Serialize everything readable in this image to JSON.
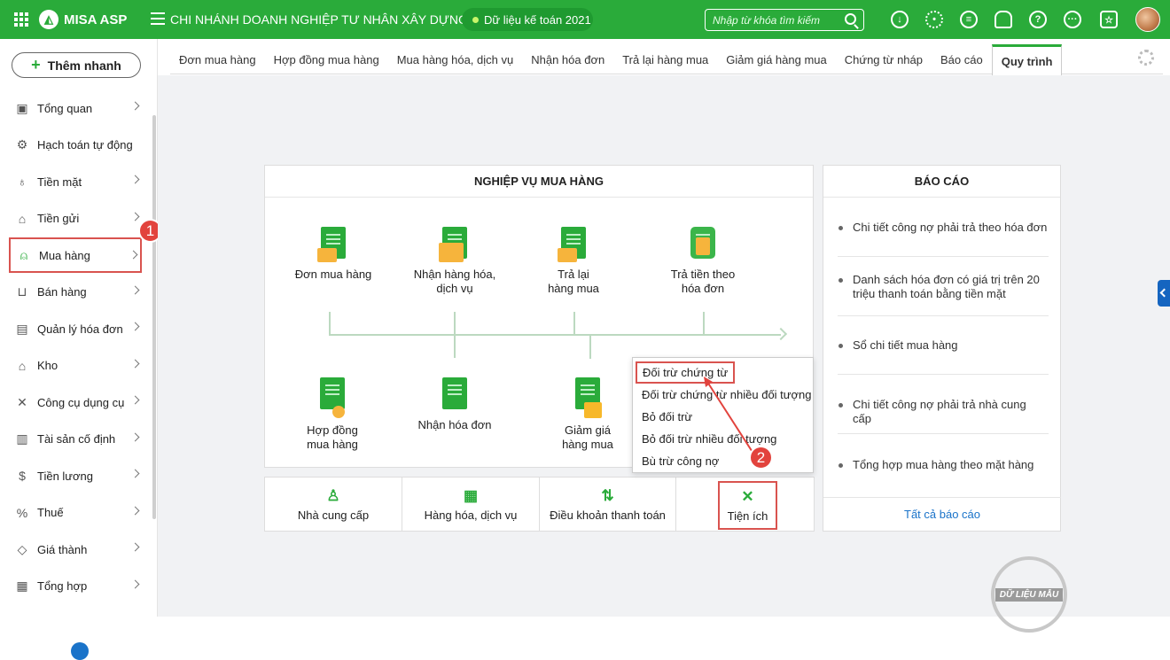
{
  "topbar": {
    "brand": "MISA ASP",
    "company": "CHI NHÁNH DOANH NGHIỆP TƯ NHÂN XÂY DỰNG ...",
    "db_label": "Dữ liệu kế toán 2021",
    "search_placeholder": "Nhập từ khóa tìm kiếm",
    "icons": [
      "download-icon",
      "settings-icon",
      "chat-icon",
      "bell-icon",
      "help-icon",
      "more-icon",
      "news-icon"
    ]
  },
  "sidebar": {
    "quick_add": "Thêm nhanh",
    "items": [
      {
        "label": "Tổng quan",
        "icon": "dashboard-icon",
        "chevron": true
      },
      {
        "label": "Hạch toán tự động",
        "icon": "auto-gear-icon",
        "chevron": false
      },
      {
        "label": "Tiền mặt",
        "icon": "money-bag-icon",
        "chevron": true
      },
      {
        "label": "Tiền gửi",
        "icon": "bank-icon",
        "chevron": true
      },
      {
        "label": "Mua hàng",
        "icon": "shopping-bag-icon",
        "chevron": true,
        "active": true
      },
      {
        "label": "Bán hàng",
        "icon": "cart-icon",
        "chevron": true
      },
      {
        "label": "Quản lý hóa đơn",
        "icon": "invoice-icon",
        "chevron": true
      },
      {
        "label": "Kho",
        "icon": "warehouse-icon",
        "chevron": true
      },
      {
        "label": "Công cụ dụng cụ",
        "icon": "tools-icon",
        "chevron": true
      },
      {
        "label": "Tài sản cố định",
        "icon": "asset-icon",
        "chevron": true
      },
      {
        "label": "Tiền lương",
        "icon": "salary-icon",
        "chevron": true
      },
      {
        "label": "Thuế",
        "icon": "tax-icon",
        "chevron": true
      },
      {
        "label": "Giá thành",
        "icon": "price-tag-icon",
        "chevron": true
      },
      {
        "label": "Tổng hợp",
        "icon": "summary-icon",
        "chevron": true
      }
    ]
  },
  "annotations": {
    "badge1": "1",
    "badge2": "2"
  },
  "tabs": [
    "Đơn mua hàng",
    "Hợp đồng mua hàng",
    "Mua hàng hóa, dịch vụ",
    "Nhận hóa đơn",
    "Trả lại hàng mua",
    "Giảm giá hàng mua",
    "Chứng từ nháp",
    "Báo cáo",
    "Quy trình"
  ],
  "selected_tab": "Quy trình",
  "process": {
    "title": "NGHIỆP VỤ MUA HÀNG",
    "top_steps": [
      {
        "l1": "Đơn mua hàng",
        "l2": ""
      },
      {
        "l1": "Nhận hàng hóa,",
        "l2": "dịch vụ"
      },
      {
        "l1": "Trả lại",
        "l2": "hàng mua"
      },
      {
        "l1": "Trả tiền theo",
        "l2": "hóa đơn"
      }
    ],
    "bottom_steps": [
      {
        "l1": "Hợp đồng",
        "l2": "mua hàng"
      },
      {
        "l1": "Nhận hóa đơn",
        "l2": ""
      },
      {
        "l1": "Giảm giá",
        "l2": "hàng mua"
      }
    ]
  },
  "menu": [
    "Đối trừ chứng từ",
    "Đối trừ chứng từ nhiều đối tượng",
    "Bỏ đối trừ",
    "Bỏ đối trừ nhiều đối tượng",
    "Bù trừ công nợ"
  ],
  "utilities": [
    "Nhà cung cấp",
    "Hàng hóa, dịch vụ",
    "Điều khoản thanh toán",
    "Tiện ích"
  ],
  "reports": {
    "title": "BÁO CÁO",
    "items": [
      "Chi tiết công nợ phải trả theo hóa đơn",
      "Danh sách hóa đơn có giá trị trên 20 triệu thanh toán bằng tiền mặt",
      "Sổ chi tiết mua hàng",
      "Chi tiết công nợ phải trả nhà cung cấp",
      "Tổng hợp mua hàng theo mặt hàng"
    ],
    "all": "Tất cả báo cáo"
  },
  "stamp": "DỮ LIỆU MẪU",
  "colors": {
    "brand": "#2aab3a",
    "highlight": "#d9534f",
    "link": "#1a73c9"
  }
}
